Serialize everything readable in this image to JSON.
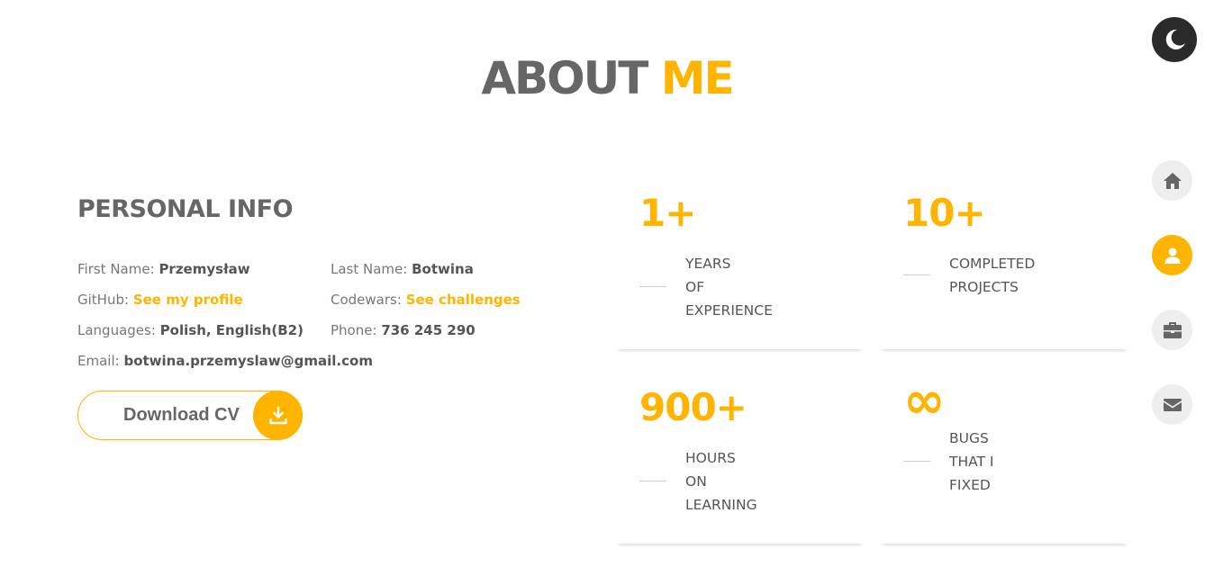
{
  "header": {
    "title_main": "ABOUT",
    "title_accent": "ME"
  },
  "theme_toggle": {
    "icon": "moon-icon"
  },
  "nav": [
    {
      "icon": "home-icon",
      "active": false
    },
    {
      "icon": "user-icon",
      "active": true
    },
    {
      "icon": "briefcase-icon",
      "active": false
    },
    {
      "icon": "envelope-icon",
      "active": false
    }
  ],
  "personal_info": {
    "heading": "PERSONAL INFO",
    "first_name_label": "First Name:",
    "first_name_value": "Przemysław",
    "last_name_label": "Last Name:",
    "last_name_value": "Botwina",
    "github_label": "GitHub:",
    "github_link": "See my profile",
    "codewars_label": "Codewars:",
    "codewars_link": "See challenges",
    "languages_label": "Languages:",
    "languages_value": "Polish, English(B2)",
    "phone_label": "Phone:",
    "phone_value": "736 245 290",
    "email_label": "Email:",
    "email_value": "botwina.przemyslaw@gmail.com",
    "download_label": "Download CV"
  },
  "stats": [
    {
      "number": "1+",
      "label_lines": [
        "YEARS",
        "OF",
        "EXPERIENCE"
      ]
    },
    {
      "number": "10+",
      "label_lines": [
        "COMPLETED",
        "PROJECTS"
      ]
    },
    {
      "number": "900+",
      "label_lines": [
        "HOURS",
        "ON",
        "LEARNING"
      ]
    },
    {
      "number": "∞",
      "label_lines": [
        "BUGS",
        "THAT I",
        "FIXED"
      ]
    }
  ],
  "colors": {
    "accent": "#ffb400",
    "text": "#666666",
    "nav_bg": "#eeeeee",
    "toggle_bg": "#2b2a2a"
  }
}
